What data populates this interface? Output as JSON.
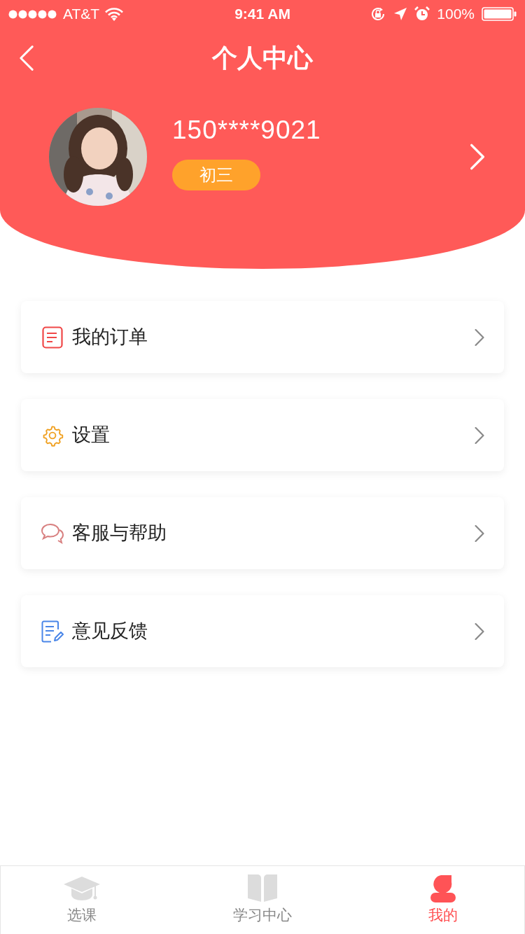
{
  "status_bar": {
    "carrier": "AT&T",
    "time": "9:41 AM",
    "battery": "100%"
  },
  "nav": {
    "title": "个人中心"
  },
  "profile": {
    "phone": "150****9021",
    "grade": "初三"
  },
  "menu": [
    {
      "kind": "order",
      "label": "我的订单",
      "color": "#f04848"
    },
    {
      "kind": "settings",
      "label": "设置",
      "color": "#f0a020"
    },
    {
      "kind": "support",
      "label": "客服与帮助",
      "color": "#d88080"
    },
    {
      "kind": "feedback",
      "label": "意见反馈",
      "color": "#4a86e8"
    }
  ],
  "tab_bar": [
    {
      "kind": "courses",
      "label": "选课",
      "selected": false
    },
    {
      "kind": "study",
      "label": "学习中心",
      "selected": false
    },
    {
      "kind": "mine",
      "label": "我的",
      "selected": true
    }
  ]
}
